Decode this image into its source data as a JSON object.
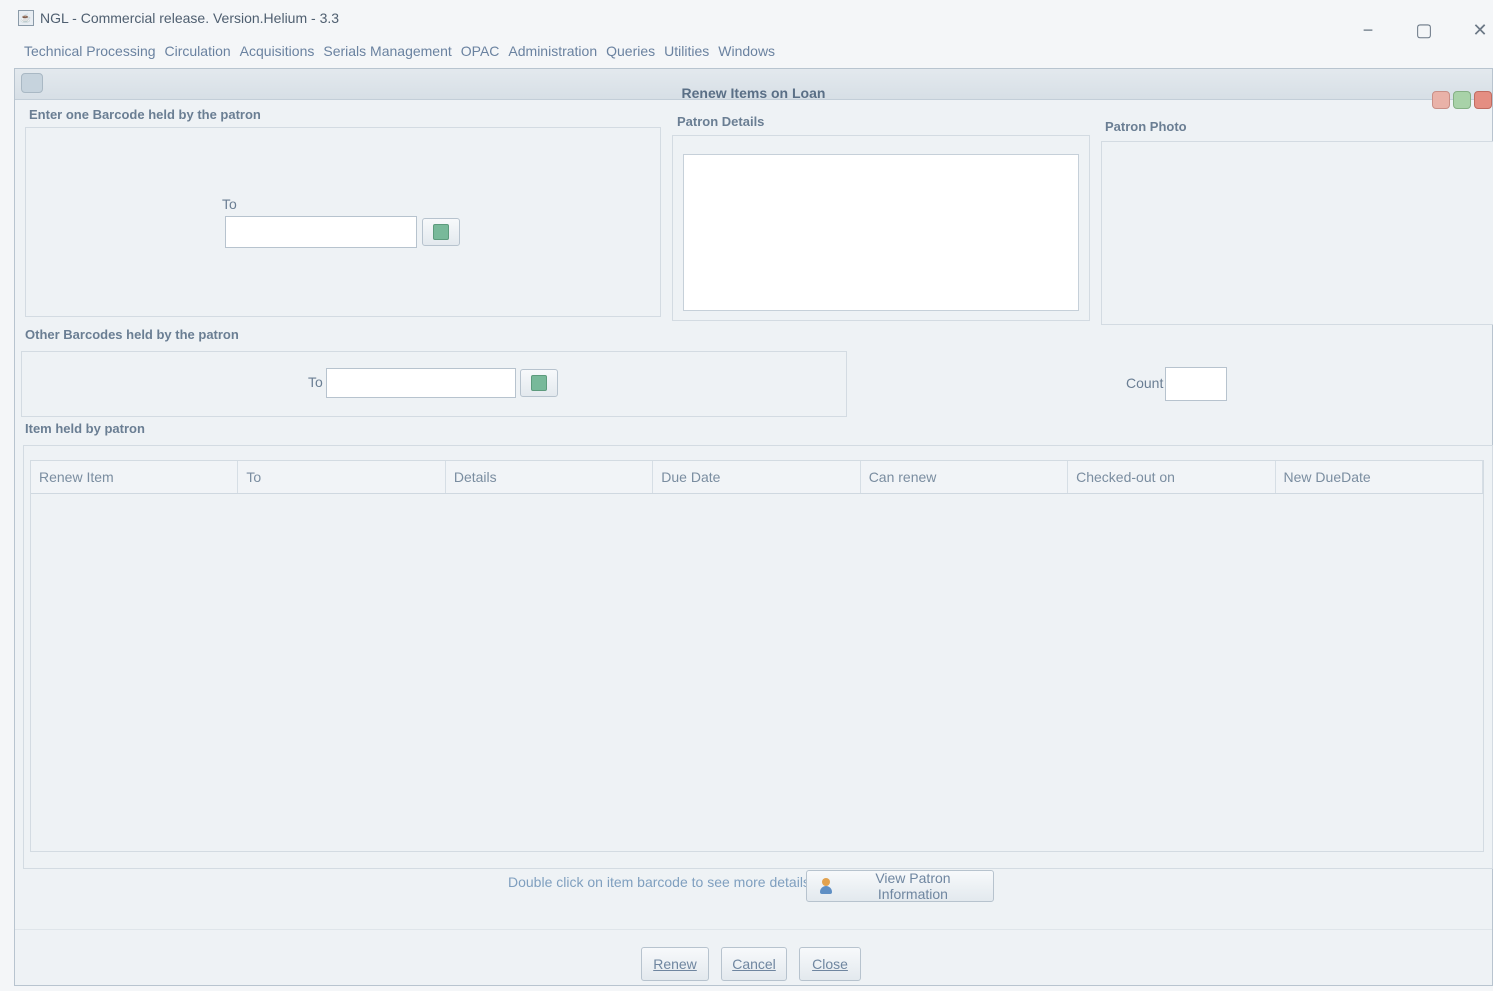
{
  "window": {
    "title": "NGL - Commercial release. Version.Helium - 3.3",
    "controls": [
      "−",
      "▢",
      "✕"
    ]
  },
  "menu": [
    "Technical Processing",
    "Circulation",
    "Acquisitions",
    "Serials Management",
    "OPAC",
    "Administration",
    "Queries",
    "Utilities",
    "Windows"
  ],
  "frame": {
    "title": "Renew Items on Loan"
  },
  "sections": {
    "enter_barcode": "Enter one Barcode held by the patron",
    "patron_details": "Patron Details",
    "patron_photo": "Patron Photo",
    "other_barcodes": "Other Barcodes held by the patron",
    "items_held": "Item held by patron"
  },
  "fields": {
    "to_label_1": "To",
    "to_value_1": "",
    "to_label_2": "To",
    "to_value_2": "",
    "count_label": "Count",
    "count_value": ""
  },
  "table": {
    "columns": [
      "Renew Item",
      "To",
      "Details",
      "Due Date",
      "Can renew",
      "Checked-out on",
      "New DueDate"
    ],
    "rows": []
  },
  "hint": "Double click on item barcode to see more details",
  "buttons": {
    "view_patron": "View Patron Information",
    "renew": "Renew",
    "cancel": "Cancel",
    "close": "Close"
  },
  "colors": {
    "accent": "#5a6f86",
    "frame_bg": "#eef2f5",
    "go_icon": "#78b99a"
  }
}
